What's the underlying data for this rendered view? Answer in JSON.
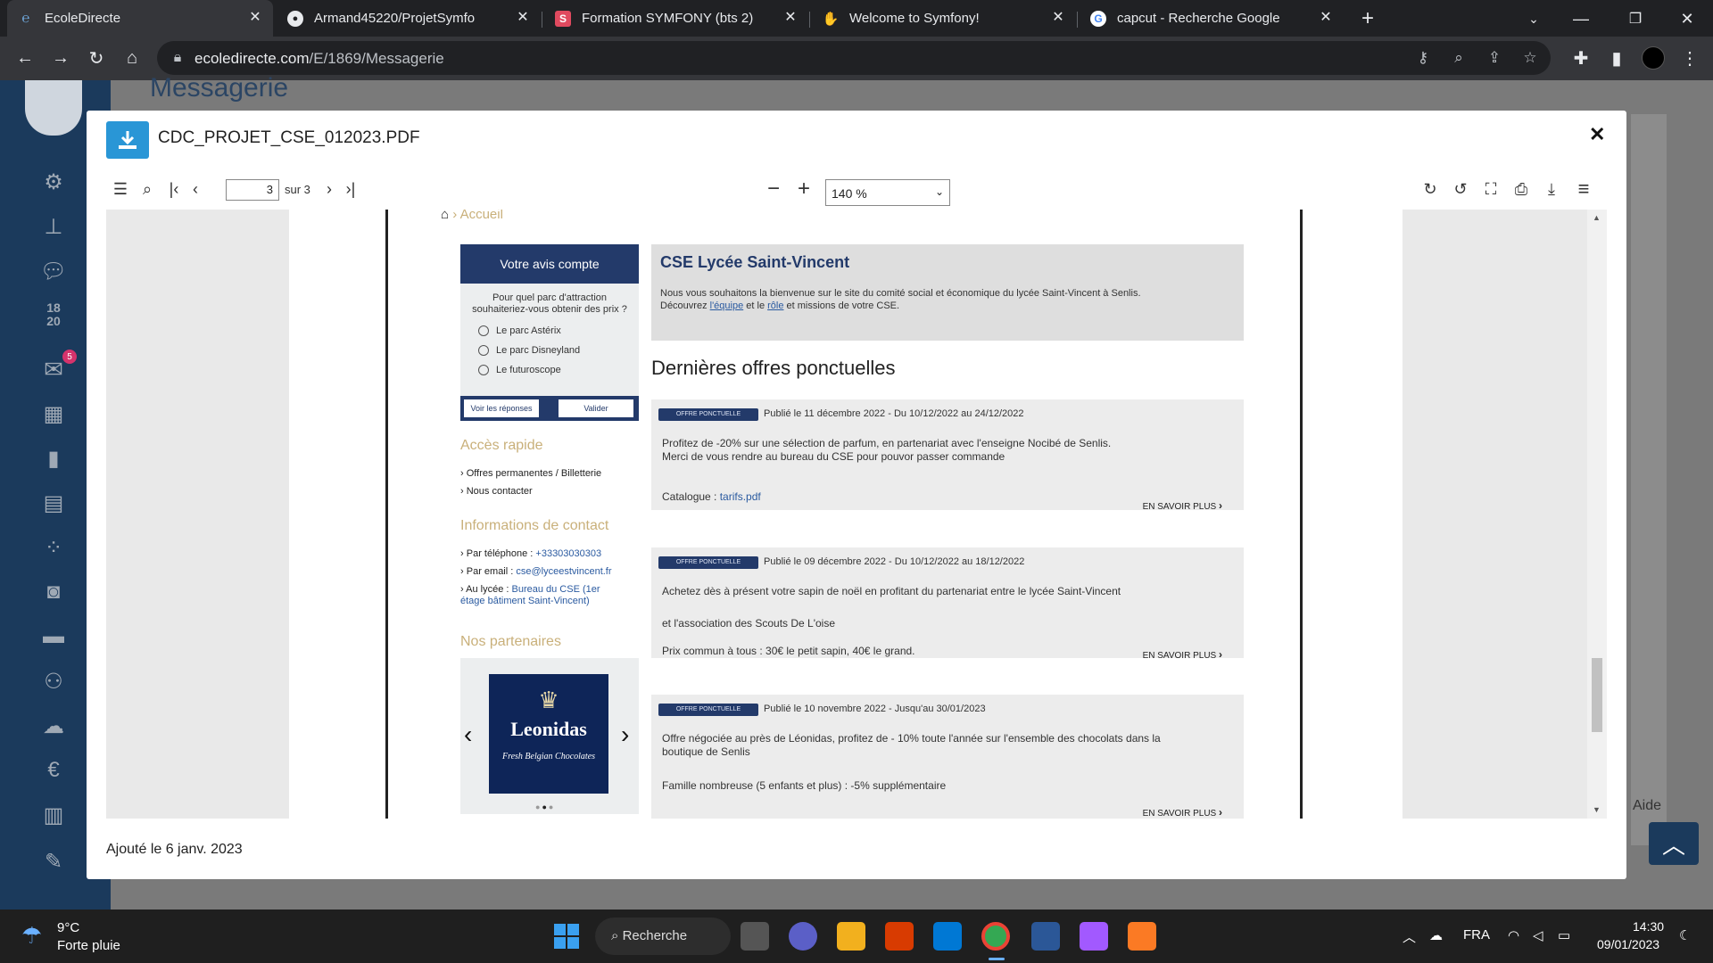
{
  "browser": {
    "tabs": [
      {
        "title": "EcoleDirecte",
        "active": true,
        "icon": "ecoledirecte-icon"
      },
      {
        "title": "Armand45220/ProjetSymfo",
        "active": false,
        "icon": "github-icon"
      },
      {
        "title": "Formation SYMFONY (bts 2)",
        "active": false,
        "icon": "s-icon"
      },
      {
        "title": "Welcome to Symfony!",
        "active": false,
        "icon": "wave-icon"
      },
      {
        "title": "capcut - Recherche Google",
        "active": false,
        "icon": "google-icon"
      }
    ],
    "url_host": "ecoledirecte.com",
    "url_path": "/E/1869/Messagerie"
  },
  "site": {
    "title": "Messagerie",
    "sidebar_badge": "5",
    "sidebar_calendar": [
      "18",
      "20"
    ],
    "aide": "Aide"
  },
  "modal": {
    "filename": "CDC_PROJET_CSE_012023.PDF",
    "footer": "Ajouté le 6 janv. 2023",
    "viewer": {
      "page": "3",
      "total": "sur 3",
      "zoom": "140 %"
    }
  },
  "pdf": {
    "breadcrumb": "Accueil",
    "poll": {
      "header": "Votre avis compte",
      "question": "Pour quel parc d'attraction souhaiteriez-vous obtenir des prix ?",
      "options": [
        "Le parc Astérix",
        "Le parc Disneyland",
        "Le futuroscope"
      ],
      "btn_results": "Voir les réponses",
      "btn_submit": "Valider"
    },
    "quick_access": {
      "title": "Accès rapide",
      "items": [
        "Offres permanentes / Billetterie",
        "Nous contacter"
      ]
    },
    "contact": {
      "title": "Informations de contact",
      "phone_label": "Par téléphone : ",
      "phone": "+33303030303",
      "email_label": "Par email : ",
      "email": "cse@lyceestvincent.fr",
      "place_label": "Au lycée : ",
      "place": "Bureau du CSE (1er étage bâtiment Saint-Vincent)"
    },
    "partners": {
      "title": "Nos partenaires",
      "logo_name": "Leonidas",
      "logo_sub": "Fresh Belgian Chocolates"
    },
    "cse": {
      "title": "CSE Lycée Saint-Vincent",
      "intro": "Nous vous souhaitons la bienvenue sur le site du comité social et économique du lycée Saint-Vincent à Senlis.",
      "discover_a": "Découvrez ",
      "link1": "l'équipe",
      "discover_b": " et le ",
      "link2": "rôle",
      "discover_c": " et missions de votre CSE."
    },
    "offers_title": "Dernières offres ponctuelles",
    "offers": [
      {
        "badge": "OFFRE PONCTUELLE",
        "published": "Publié le 11 décembre 2022 - Du 10/12/2022 au 24/12/2022",
        "line1": "Profitez de -20% sur une sélection de parfum, en partenariat avec l'enseigne Nocibé de Senlis.",
        "line2": "Merci de vous rendre au bureau du CSE pour pouvor passer commande",
        "line3_label": "Catalogue : ",
        "line3_link": "tarifs.pdf",
        "more": "EN SAVOIR PLUS"
      },
      {
        "badge": "OFFRE PONCTUELLE",
        "published": "Publié le 09 décembre 2022 - Du 10/12/2022 au 18/12/2022",
        "line1": "Achetez dès à présent votre sapin de noël en profitant du partenariat entre le lycée Saint-Vincent",
        "line2": "et l'association des Scouts De L'oise",
        "line3": "Prix commun à tous : 30€ le petit sapin, 40€ le grand.",
        "more": "EN SAVOIR PLUS"
      },
      {
        "badge": "OFFRE PONCTUELLE",
        "published": "Publié le 10 novembre 2022 - Jusqu'au 30/01/2023",
        "line1": "Offre négociée au près de Léonidas, profitez de - 10% toute l'année sur l'ensemble des chocolats dans la boutique de Senlis",
        "line3": "Famille nombreuse (5 enfants et plus) : -5% supplémentaire",
        "more": "EN SAVOIR PLUS"
      }
    ]
  },
  "taskbar": {
    "weather_temp": "9°C",
    "weather_desc": "Forte pluie",
    "search": "Recherche",
    "lang": "FRA",
    "time": "14:30",
    "date": "09/01/2023"
  },
  "colors": {
    "accent": "#2996d6",
    "cse_navy": "#233a6a",
    "gold": "#c9b07a"
  }
}
